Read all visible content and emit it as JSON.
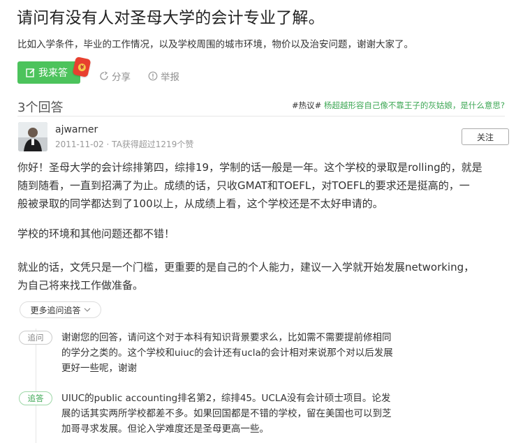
{
  "question": {
    "title": "请问有没有人对圣母大学的会计专业了解。",
    "description": "比如入学条件，毕业的工作情况，以及学校周围的城市环境，物价以及治安问题，谢谢大家了。"
  },
  "actions": {
    "answer_label": "我来答",
    "share_label": "分享",
    "report_label": "举报",
    "redpacket_glyph": "¥"
  },
  "answers_header": {
    "count_label": "3个回答",
    "hot_tag": "#热议#",
    "hot_link": "杨超越形容自己像不靠王子的灰姑娘，是什么意思?"
  },
  "answer": {
    "username": "ajwarner",
    "meta": "2011-11-02 · TA获得超过1219个赞",
    "follow_label": "关注",
    "paragraphs": [
      [
        "你好！圣母大学的会计综排第四，综排19，学制的话一般是一年。这个学校的录取是rolling的，就是",
        "随到随看，一直到招满了为止。成绩的话，只收GMAT和TOEFL，对TOEFL的要求还是挺高的，一",
        "般被录取的同学都达到了100以上，从成绩上看，这个学校还是不太好申请的。"
      ],
      [
        "学校的环境和其他问题还都不错！"
      ],
      [
        "就业的话，文凭只是一个门槛，更重要的是自己的个人能力，建议一入学就开始发展networking，",
        "为自己将来找工作做准备。"
      ]
    ]
  },
  "followups": {
    "more_label": "更多追问追答",
    "items": [
      {
        "tag": "追问",
        "lines": [
          "谢谢您的回答，请问这个对于本科有知识背景要求么，比如需不需要提前修相同",
          "的学分之类的。这个学校和uiuc的会计还有ucla的会计相对来说那个对以后发展",
          "更好一些呢，谢谢"
        ]
      },
      {
        "tag": "追答",
        "lines": [
          "UIUC的public accounting排名第2，综排45。UCLA没有会计硕士项目。论发",
          "展的话其实两所学校都差不多。如果回国都是不错的学校，留在美国也可以到芝",
          "加哥寻求发展。但论入学难度还是圣母更高一些。"
        ]
      }
    ]
  },
  "colors": {
    "accent_green": "#4cc35c",
    "link_green": "#3fa856",
    "muted_text": "#999999"
  }
}
